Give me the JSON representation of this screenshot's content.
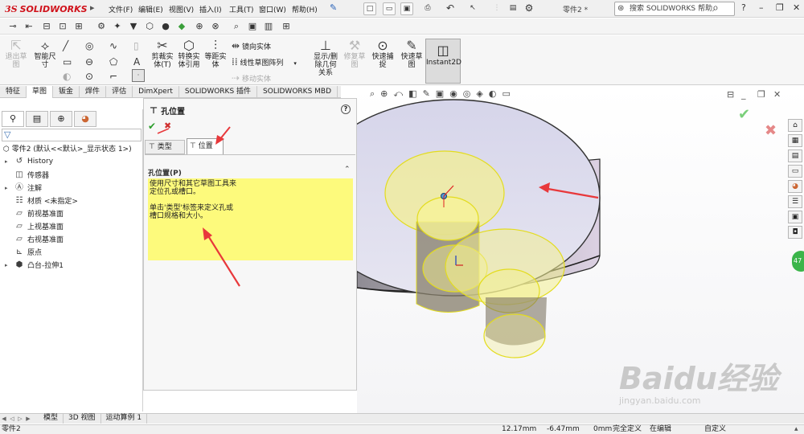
{
  "app": {
    "logo_prefix": "3S",
    "logo_text": "SOLIDWORKS",
    "doc_title": "零件2 *"
  },
  "menu": {
    "items": [
      "文件(F)",
      "编辑(E)",
      "视图(V)",
      "插入(I)",
      "工具(T)",
      "窗口(W)",
      "帮助(H)"
    ]
  },
  "help_search": {
    "placeholder": "搜索 SOLIDWORKS 帮助"
  },
  "ribbon": {
    "exit_sketch": "退出草图",
    "smart_dim": "智能尺寸",
    "trim": "剪裁实体(T)",
    "convert": "转换实体引用",
    "offset": "等距实体",
    "mirror": "镜向实体",
    "linear_pattern": "线性草图阵列",
    "move": "移动实体",
    "show_relations": "显示/删除几何关系",
    "repair": "修复草图",
    "quick_snaps": "快速捕捉",
    "rapid_sketch": "快速草图",
    "instant2d": "Instant2D"
  },
  "command_tabs": [
    "特征",
    "草图",
    "钣金",
    "焊件",
    "评估",
    "DimXpert",
    "SOLIDWORKS 插件",
    "SOLIDWORKS MBD"
  ],
  "command_tabs_active": "草图",
  "feature_tree": {
    "root": "零件2 (默认<<默认>_显示状态 1>)",
    "items": [
      {
        "label": "History",
        "icon": "history-icon",
        "expand": "▸"
      },
      {
        "label": "传感器",
        "icon": "sensor-icon",
        "expand": ""
      },
      {
        "label": "注解",
        "icon": "annotation-icon",
        "expand": "▸"
      },
      {
        "label": "材质 <未指定>",
        "icon": "material-icon",
        "expand": ""
      },
      {
        "label": "前视基准面",
        "icon": "plane-icon",
        "expand": ""
      },
      {
        "label": "上视基准面",
        "icon": "plane-icon",
        "expand": ""
      },
      {
        "label": "右视基准面",
        "icon": "plane-icon",
        "expand": ""
      },
      {
        "label": "原点",
        "icon": "origin-icon",
        "expand": ""
      },
      {
        "label": "凸台-拉伸1",
        "icon": "boss-extrude-icon",
        "expand": "▸"
      }
    ]
  },
  "property_manager": {
    "title": "孔位置",
    "tab_type": "类型",
    "tab_position": "位置",
    "section_title": "孔位置(P)",
    "message1": "使用尺寸和其它草图工具来\n定位孔或槽口。",
    "message2": "单击'类型'标签来定义孔或\n槽口规格和大小。"
  },
  "watermark": {
    "text": "Baidu经验",
    "url": "jingyan.baidu.com"
  },
  "side_badge": "47",
  "model_tabs": [
    "模型",
    "3D 视图",
    "运动算例 1"
  ],
  "model_tabs_active": "模型",
  "status": {
    "part": "零件2",
    "x": "12.17mm",
    "y": "-6.47mm",
    "z": "0mm",
    "state": "完全定义",
    "editing": "在编辑",
    "custom": "自定义"
  },
  "colors": {
    "accent_red": "#d0121b",
    "highlight_yellow": "#fdfa7c",
    "annotation_arrow": "#e8383b",
    "selection_yellow": "#f5f040"
  }
}
